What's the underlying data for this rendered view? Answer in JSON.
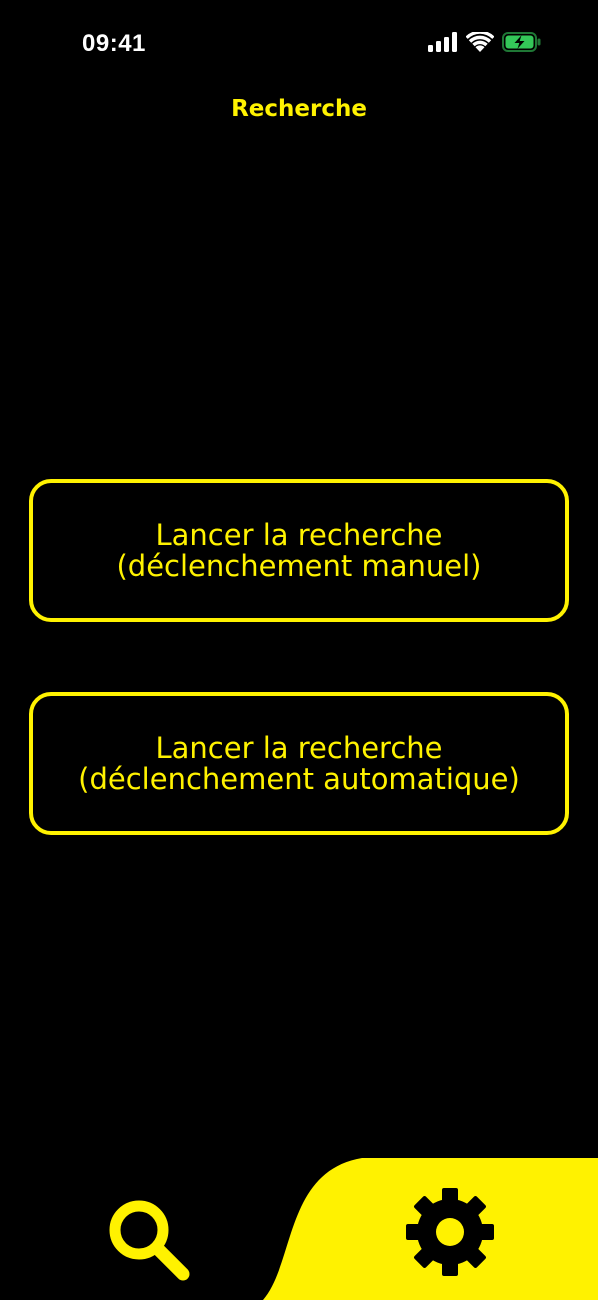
{
  "status_bar": {
    "time": "09:41",
    "signal_icon": "cellular-signal-icon",
    "wifi_icon": "wifi-icon",
    "battery_icon": "battery-charging-icon"
  },
  "header": {
    "title": "Recherche"
  },
  "actions": [
    {
      "line1": "Lancer la recherche",
      "line2": "(déclenchement manuel)"
    },
    {
      "line1": "Lancer la recherche",
      "line2": "(déclenchement automatique)"
    }
  ],
  "tab_bar": {
    "tabs": [
      {
        "icon": "search-icon",
        "active": true
      },
      {
        "icon": "gear-icon",
        "active": false
      }
    ]
  },
  "colors": {
    "accent": "#FFF200",
    "background": "#000000",
    "battery": "#34C759"
  }
}
